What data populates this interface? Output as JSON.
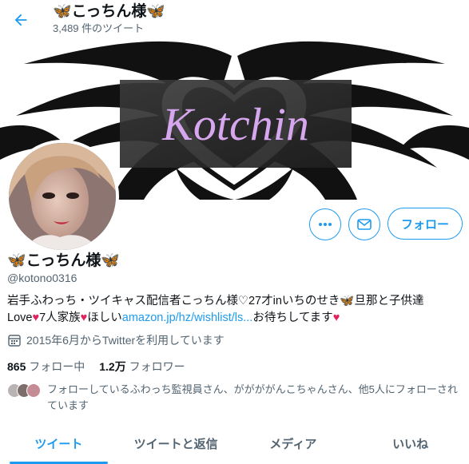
{
  "header": {
    "back_icon": "arrow-left-icon",
    "title_emoji_left": "🦋",
    "title": "こっちん様",
    "title_emoji_right": "🦋",
    "tweet_count_label": "3,489 件のツイート"
  },
  "banner": {
    "text": "Kotchin"
  },
  "actions": {
    "more_icon": "ellipsis-icon",
    "message_icon": "envelope-icon",
    "follow_label": "フォロー"
  },
  "profile": {
    "name": "こっちん様",
    "handle": "@kotono0316",
    "bio_line1": "岩手ふわっち・ツイキャス配信者こっちん様♡27才inいちのせき",
    "bio_line1_emoji": "🦋",
    "bio_line1_end": "旦那と子供達",
    "bio_line2_a": "Love",
    "bio_line2_b": "7人家族",
    "bio_line2_c": "ほしい",
    "bio_link": "amazon.jp/hz/wishlist/ls...",
    "bio_line2_d": "お待ちしてます",
    "heart": "♥",
    "joined_icon": "calendar-icon",
    "joined": "2015年6月からTwitterを利用しています"
  },
  "stats": {
    "following_count": "865",
    "following_label": "フォロー中",
    "followers_count": "1.2万",
    "followers_label": "フォロワー"
  },
  "followed_by": {
    "text": "フォローしているふわっち監視員さん、ががががんこちゃんさん、他5人にフォローされています"
  },
  "tabs": [
    {
      "label": "ツイート",
      "active": true
    },
    {
      "label": "ツイートと返信",
      "active": false
    },
    {
      "label": "メディア",
      "active": false
    },
    {
      "label": "いいね",
      "active": false
    }
  ],
  "colors": {
    "accent": "#1d9bf0",
    "heart": "#e0245e",
    "secondary_text": "#536471"
  }
}
